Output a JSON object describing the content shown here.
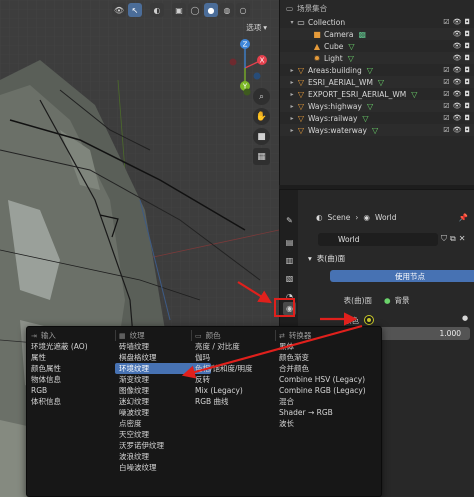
{
  "viewport": {
    "options_label": "选项",
    "header_icons": [
      "eye-icon",
      "cursor-icon",
      "overlay-icon",
      "xray-icon",
      "wireframe-icon",
      "solid-icon",
      "material-icon",
      "rendered-icon"
    ],
    "gizmo": {
      "x": "X",
      "y": "Y",
      "z": "Z"
    },
    "tools": [
      "zoom-icon",
      "hand-icon",
      "camera-icon",
      "grid-icon"
    ]
  },
  "outliner": {
    "root": "场景集合",
    "items": [
      {
        "name": "Collection",
        "icon": "collection-icon",
        "level": 0
      },
      {
        "name": "Camera",
        "icon": "camera-icon",
        "level": 1
      },
      {
        "name": "Cube",
        "icon": "mesh-icon",
        "level": 1
      },
      {
        "name": "Light",
        "icon": "light-icon",
        "level": 1
      },
      {
        "name": "Areas:building",
        "icon": "object-icon",
        "level": 0
      },
      {
        "name": "ESRI_AERIAL_WM",
        "icon": "object-icon",
        "level": 0
      },
      {
        "name": "EXPORT_ESRI_AERIAL_WM",
        "icon": "object-icon",
        "level": 0
      },
      {
        "name": "Ways:highway",
        "icon": "object-icon",
        "level": 0
      },
      {
        "name": "Ways:railway",
        "icon": "object-icon",
        "level": 0
      },
      {
        "name": "Ways:waterway",
        "icon": "object-icon",
        "level": 0
      }
    ]
  },
  "properties": {
    "breadcrumb": {
      "scene": "Scene",
      "separator": "›",
      "world": "World"
    },
    "world_field": "World",
    "surface_panel": "表(曲)面",
    "use_nodes_button": "使用节点",
    "surface_label": "表(曲)面",
    "surface_value": "背景",
    "color_label": "颜色",
    "strength_value": "1.000"
  },
  "menu": {
    "columns": [
      {
        "header": "输入",
        "items": [
          "环境光遮蔽 (AO)",
          "属性",
          "颜色属性",
          "物体信息",
          "RGB",
          "体积信息"
        ]
      },
      {
        "header": "纹理",
        "items": [
          "砖墙纹理",
          "棋盘格纹理",
          "环境纹理",
          "渐变纹理",
          "图像纹理",
          "迷幻纹理",
          "噪波纹理",
          "点密度",
          "天空纹理",
          "沃罗诺伊纹理",
          "波浪纹理",
          "白噪波纹理"
        ]
      },
      {
        "header": "颜色",
        "items": [
          "亮度 / 对比度",
          "伽玛",
          "色相/饱和度/明度",
          "反转",
          "Mix (Legacy)",
          "RGB 曲线"
        ]
      },
      {
        "header": "转换器",
        "items": [
          "黑体",
          "颜色渐变",
          "合并颜色",
          "Combine HSV (Legacy)",
          "Combine RGB (Legacy)",
          "混合",
          "Shader → RGB",
          "波长"
        ]
      }
    ],
    "selected": "环境纹理"
  },
  "colors": {
    "accent": "#4772b3",
    "annotation": "#e0201c",
    "gizmo_x": "#e5404d",
    "gizmo_y": "#7cb726",
    "gizmo_z": "#3e86d8"
  }
}
